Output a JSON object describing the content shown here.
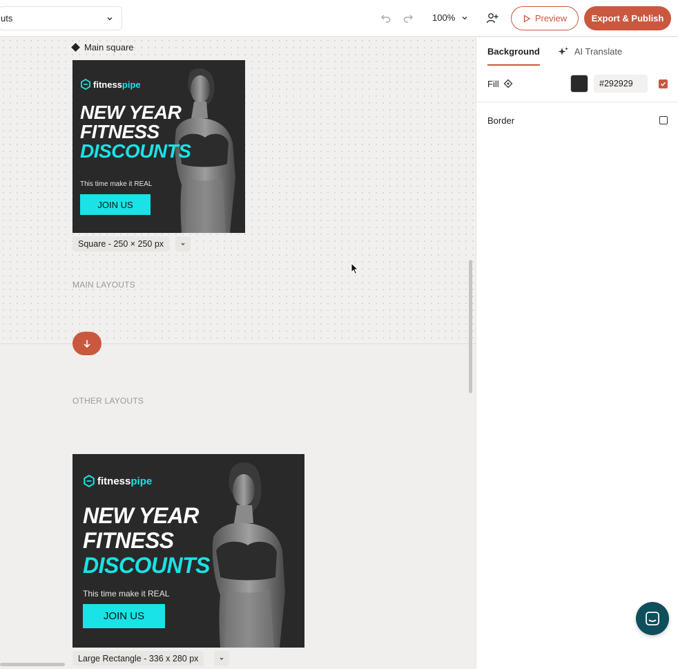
{
  "header": {
    "layout_select_value": "uts",
    "zoom_label": "100%",
    "preview_label": "Preview",
    "export_label": "Export & Publish"
  },
  "canvas": {
    "frame_label": "Main square",
    "main_layouts_label": "MAIN LAYOUTS",
    "other_layouts_label": "OTHER LAYOUTS",
    "square_size_label": "Square - 250 × 250 px",
    "large_rect_size_label": "Large Rectangle - 336 x 280 px"
  },
  "ad": {
    "brand_fitness": "fitness",
    "brand_pipe": "pipe",
    "headline_line1": "NEW YEAR",
    "headline_line2": "FITNESS",
    "headline_accent": "DISCOUNTS",
    "tagline": "This time make it REAL",
    "cta": "JOIN US"
  },
  "panel": {
    "tab_background": "Background",
    "tab_ai_translate": "AI Translate",
    "fill_label": "Fill",
    "fill_hex": "#292929",
    "fill_enabled": true,
    "border_label": "Border",
    "border_enabled": false
  },
  "colors": {
    "accent": "#c9583f",
    "ad_background": "#292929",
    "ad_highlight": "#19e3e6"
  },
  "icons": [
    "chevron-down-icon",
    "undo-icon",
    "redo-icon",
    "add-user-icon",
    "play-icon",
    "diamond-icon",
    "sparkle-icon",
    "check-icon",
    "arrow-down-icon",
    "chat-icon"
  ]
}
